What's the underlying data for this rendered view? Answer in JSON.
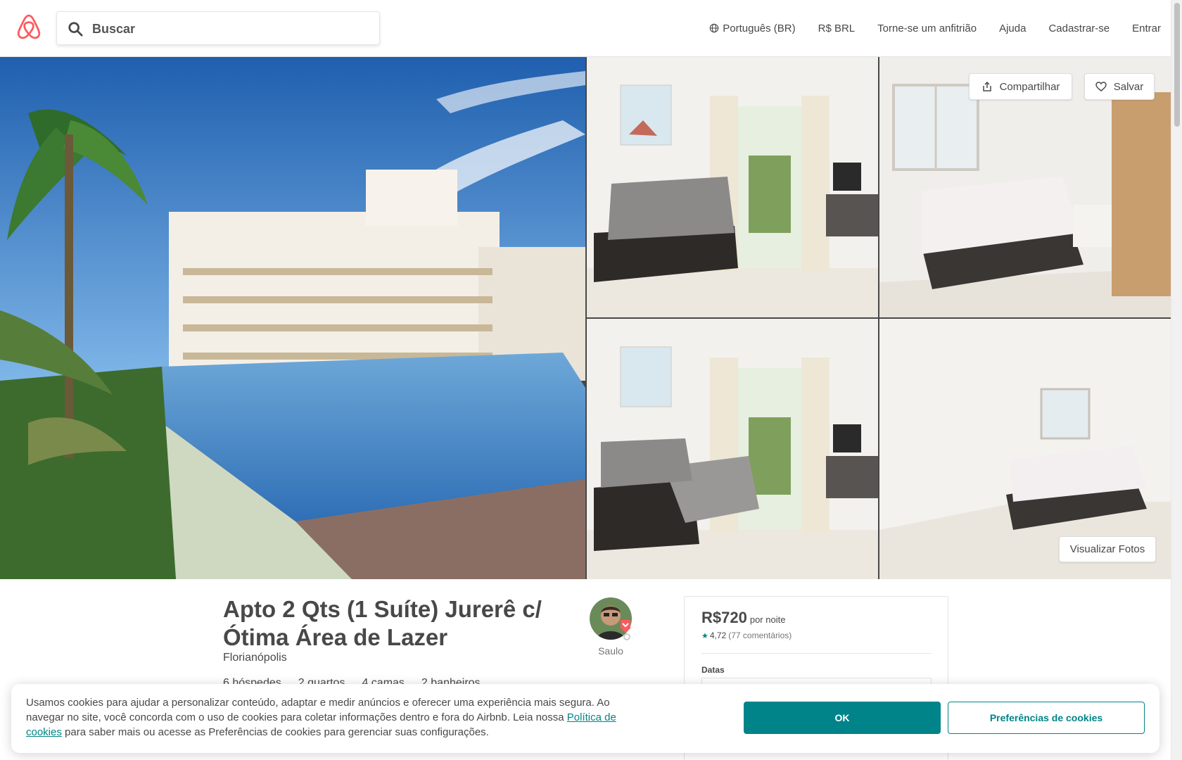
{
  "header": {
    "logo_icon": "airbnb-logo-icon",
    "search": {
      "placeholder": "Buscar",
      "icon": "search-icon"
    },
    "nav": [
      {
        "label": "Português (BR)",
        "icon": "globe-icon"
      },
      {
        "label": "R$ BRL"
      },
      {
        "label": "Torne-se um anfitrião"
      },
      {
        "label": "Ajuda"
      },
      {
        "label": "Cadastrar-se"
      },
      {
        "label": "Entrar"
      }
    ]
  },
  "gallery": {
    "share_label": "Compartilhar",
    "save_label": "Salvar",
    "view_photos_label": "Visualizar Fotos"
  },
  "listing": {
    "title": "Apto 2 Qts (1 Suíte) Jurerê c/ Ótima Área de Lazer",
    "location": "Florianópolis",
    "facts": [
      "6 hóspedes",
      "2 quartos",
      "4 camas",
      "2 banheiros"
    ],
    "host_name": "Saulo"
  },
  "booking": {
    "price": "R$720",
    "per_night": "por noite",
    "rating": "4,72",
    "reviews": "(77 comentários)",
    "dates_label": "Datas"
  },
  "cookie": {
    "text_before": "Usamos cookies para ajudar a personalizar conteúdo, adaptar e medir anúncios e oferecer uma experiência mais segura. Ao navegar no site, você concorda com o uso de cookies para coletar informações dentro e fora do Airbnb. Leia nossa ",
    "link_text": "Política de cookies",
    "text_after": " para saber mais ou acesse as Preferências de cookies para gerenciar suas configurações.",
    "ok_label": "OK",
    "prefs_label": "Preferências de cookies"
  },
  "colors": {
    "brand": "#FF5A5F",
    "teal": "#008489",
    "text": "#484848"
  }
}
